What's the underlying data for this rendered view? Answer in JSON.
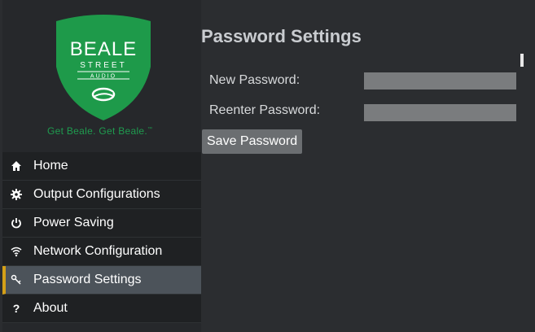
{
  "brand": {
    "line1": "BEALE",
    "line2": "STREET",
    "line3": "AUDIO",
    "tagline": "Get Beale. Get Beale.",
    "trademark": "™",
    "shield_color": "#1e9a4a"
  },
  "sidebar": {
    "items": [
      {
        "label": "Home",
        "icon": "home-icon"
      },
      {
        "label": "Output Configurations",
        "icon": "gear-icon"
      },
      {
        "label": "Power Saving",
        "icon": "power-icon"
      },
      {
        "label": "Network Configuration",
        "icon": "wifi-icon"
      },
      {
        "label": "Password Settings",
        "icon": "key-icon",
        "active": true
      },
      {
        "label": "About",
        "icon": "question-icon"
      }
    ],
    "active_color": "#d4a017"
  },
  "main": {
    "title": "Password Settings",
    "fields": [
      {
        "label": "New Password:",
        "value": ""
      },
      {
        "label": "Reenter Password:",
        "value": ""
      }
    ],
    "save_label": "Save Password"
  }
}
